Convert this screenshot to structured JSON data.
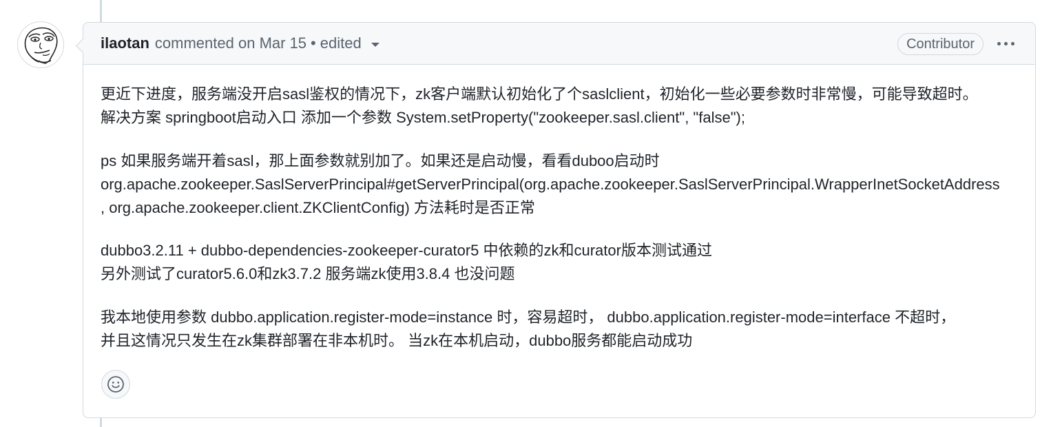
{
  "comment": {
    "author": "ilaotan",
    "action": "commented on",
    "date": "Mar 15",
    "separator": "•",
    "edited_label": "edited",
    "badge": "Contributor",
    "body": {
      "p1": {
        "line1": "更近下进度，服务端没开启sasl鉴权的情况下，zk客户端默认初始化了个saslclient，初始化一些必要参数时非常慢，可能导致超时。",
        "line2": "解决方案 springboot启动入口 添加一个参数 System.setProperty(\"zookeeper.sasl.client\", \"false\");"
      },
      "p2": {
        "line1": "ps 如果服务端开着sasl，那上面参数就别加了。如果还是启动慢，看看duboo启动时",
        "line2": "org.apache.zookeeper.SaslServerPrincipal#getServerPrincipal(org.apache.zookeeper.SaslServerPrincipal.WrapperInetSocketAddress",
        "line3": ", org.apache.zookeeper.client.ZKClientConfig) 方法耗时是否正常"
      },
      "p3": {
        "line1": "dubbo3.2.11 + dubbo-dependencies-zookeeper-curator5 中依赖的zk和curator版本测试通过",
        "line2": "另外测试了curator5.6.0和zk3.7.2 服务端zk使用3.8.4 也没问题"
      },
      "p4": {
        "line1": "我本地使用参数 dubbo.application.register-mode=instance 时，容易超时， dubbo.application.register-mode=interface 不超时，",
        "line2": "并且这情况只发生在zk集群部署在非本机时。 当zk在本机启动，dubbo服务都能启动成功"
      }
    },
    "icons": {
      "avatar": "meme-face-avatar",
      "menu": "kebab-horizontal-icon",
      "reaction": "smiley-icon",
      "edited_menu": "triangle-down-icon"
    }
  },
  "colors": {
    "border": "#d1d9e0",
    "header_bg": "#f6f8fa",
    "muted_text": "#59636e",
    "text": "#1f2328"
  }
}
